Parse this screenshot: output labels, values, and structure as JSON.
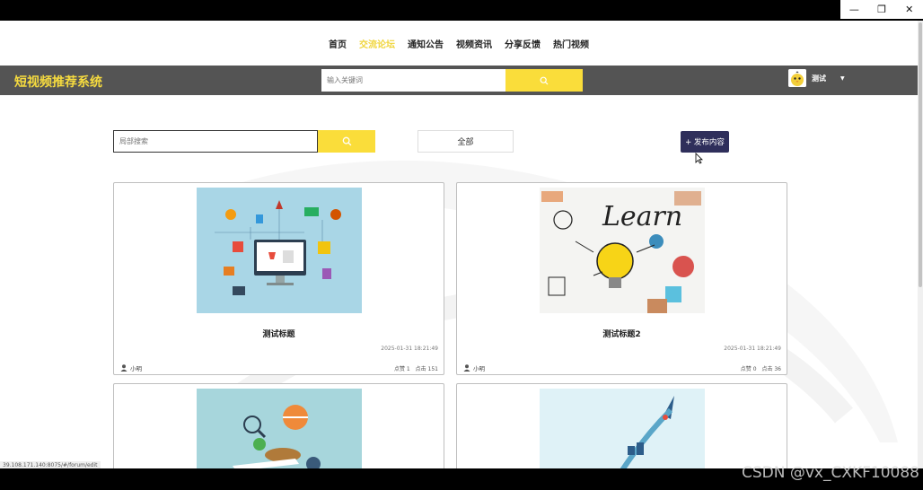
{
  "window": {
    "minimize": "—",
    "restore": "❐",
    "close": "✕"
  },
  "topnav": {
    "items": [
      {
        "label": "首页",
        "active": false
      },
      {
        "label": "交流论坛",
        "active": true
      },
      {
        "label": "通知公告",
        "active": false
      },
      {
        "label": "视频资讯",
        "active": false
      },
      {
        "label": "分享反馈",
        "active": false
      },
      {
        "label": "热门视频",
        "active": false
      }
    ]
  },
  "header": {
    "brand": "短视频推荐系统",
    "search_placeholder": "输入关键词",
    "username": "测试",
    "caret": "▼"
  },
  "filters": {
    "local_search_placeholder": "局部搜索",
    "category": "全部",
    "publish_label": "+ 发布内容"
  },
  "cards": [
    {
      "title": "测试标题",
      "date": "2025-01-31 18:21:49",
      "author": "小明",
      "favorites": "点赞 1",
      "clicks": "点击 151"
    },
    {
      "title": "测试标题2",
      "date": "2025-01-31 18:21:49",
      "author": "小明",
      "favorites": "点赞 0",
      "clicks": "点击 36"
    },
    {
      "title": "",
      "date": "",
      "author": "",
      "favorites": "",
      "clicks": ""
    },
    {
      "title": "",
      "date": "",
      "author": "",
      "favorites": "",
      "clicks": ""
    }
  ],
  "status_url": "39.108.171.140:8075/#/forum/edit",
  "watermark": "CSDN @vx_CXKF10088",
  "colors": {
    "accent": "#fadd3a",
    "header_bg": "#545454",
    "publish_bg": "#2f2f5b"
  }
}
